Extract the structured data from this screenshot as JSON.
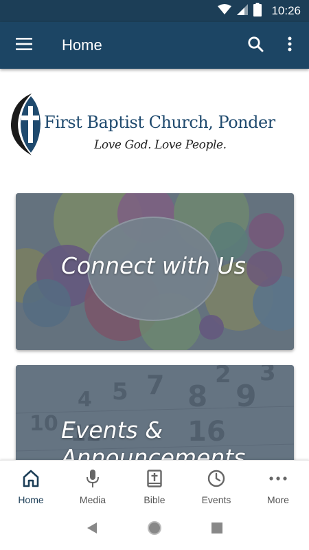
{
  "status_bar": {
    "time": "10:26",
    "icons": [
      "wifi-icon",
      "signal-icon",
      "battery-icon"
    ]
  },
  "app_bar": {
    "title": "Home",
    "menu_icon": "hamburger-menu-icon",
    "search_icon": "search-icon",
    "overflow_icon": "more-vertical-icon"
  },
  "logo": {
    "name": "First Baptist Church, Ponder",
    "tagline": "Love God. Love People."
  },
  "cards": [
    {
      "title": "Connect with Us"
    },
    {
      "title": "Events & Announcements"
    }
  ],
  "bottom_nav": {
    "items": [
      {
        "label": "Home",
        "icon": "home-icon",
        "active": true
      },
      {
        "label": "Media",
        "icon": "microphone-icon",
        "active": false
      },
      {
        "label": "Bible",
        "icon": "bible-icon",
        "active": false
      },
      {
        "label": "Events",
        "icon": "clock-icon",
        "active": false
      },
      {
        "label": "More",
        "icon": "more-horizontal-icon",
        "active": false
      }
    ]
  },
  "colors": {
    "primary": "#1c4564",
    "status_bar": "#1c3e57",
    "logo_text": "#1f4a6e"
  }
}
